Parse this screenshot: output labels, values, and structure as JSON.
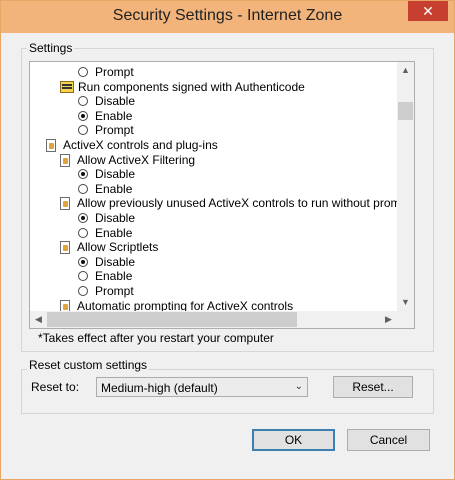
{
  "window": {
    "title": "Security Settings - Internet Zone",
    "close_glyph": "✕"
  },
  "settings": {
    "group_label": "Settings",
    "rows": [
      {
        "type": "radio",
        "label": "Prompt",
        "checked": false,
        "indent": 2
      },
      {
        "type": "cert",
        "label": "Run components signed with Authenticode",
        "indent": 1
      },
      {
        "type": "radio",
        "label": "Disable",
        "checked": false,
        "indent": 2
      },
      {
        "type": "radio",
        "label": "Enable",
        "checked": true,
        "indent": 2
      },
      {
        "type": "radio",
        "label": "Prompt",
        "checked": false,
        "indent": 2
      },
      {
        "type": "page",
        "label": "ActiveX controls and plug-ins",
        "indent": 0
      },
      {
        "type": "page",
        "label": "Allow ActiveX Filtering",
        "indent": 1
      },
      {
        "type": "radio",
        "label": "Disable",
        "checked": true,
        "indent": 2
      },
      {
        "type": "radio",
        "label": "Enable",
        "checked": false,
        "indent": 2
      },
      {
        "type": "page",
        "label": "Allow previously unused ActiveX controls to run without promp",
        "indent": 1
      },
      {
        "type": "radio",
        "label": "Disable",
        "checked": true,
        "indent": 2
      },
      {
        "type": "radio",
        "label": "Enable",
        "checked": false,
        "indent": 2
      },
      {
        "type": "page",
        "label": "Allow Scriptlets",
        "indent": 1
      },
      {
        "type": "radio",
        "label": "Disable",
        "checked": true,
        "indent": 2
      },
      {
        "type": "radio",
        "label": "Enable",
        "checked": false,
        "indent": 2
      },
      {
        "type": "radio",
        "label": "Prompt",
        "checked": false,
        "indent": 2
      },
      {
        "type": "page",
        "label": "Automatic prompting for ActiveX controls",
        "indent": 1
      }
    ],
    "note": "*Takes effect after you restart your computer"
  },
  "reset": {
    "group_label": "Reset custom settings",
    "reset_to_label": "Reset to:",
    "selected": "Medium-high (default)",
    "reset_button": "Reset..."
  },
  "buttons": {
    "ok": "OK",
    "cancel": "Cancel"
  },
  "colors": {
    "titlebar": "#f2b47a",
    "window_border": "#e8a565",
    "close_button": "#c7402f"
  }
}
